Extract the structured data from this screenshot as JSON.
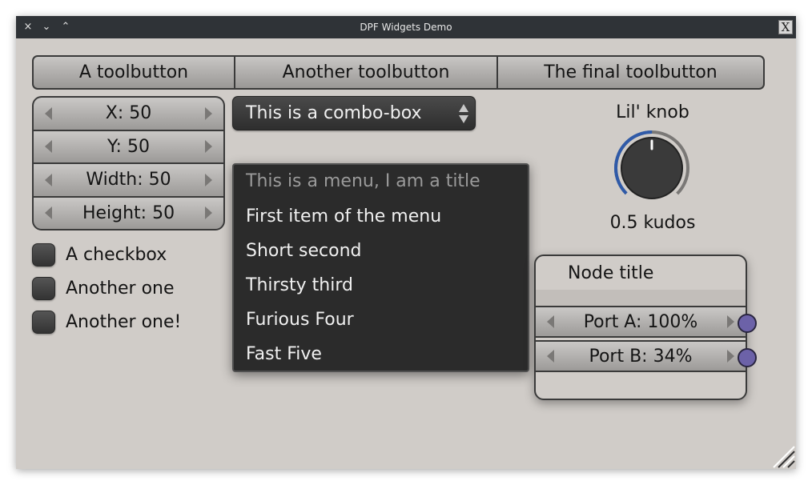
{
  "window": {
    "title": "DPF Widgets Demo",
    "controls": [
      "×",
      "⌄",
      "⌃"
    ]
  },
  "toolbar": {
    "buttons": [
      "A toolbutton",
      "Another toolbutton",
      "The final toolbutton"
    ]
  },
  "spinners": [
    {
      "label": "X: 50"
    },
    {
      "label": "Y: 50"
    },
    {
      "label": "Width: 50"
    },
    {
      "label": "Height: 50"
    }
  ],
  "checkboxes": [
    {
      "label": "A checkbox",
      "checked": false
    },
    {
      "label": "Another one",
      "checked": false
    },
    {
      "label": "Another one!",
      "checked": false
    }
  ],
  "combo": {
    "value": "This is a combo-box"
  },
  "menu": {
    "title": "This is a menu, I am a title",
    "items": [
      "First item of the menu",
      "Short second",
      "Thirsty third",
      "Furious Four",
      "Fast Five"
    ]
  },
  "knob": {
    "label": "Lil' knob",
    "value_text": "0.5 kudos",
    "value": 0.5,
    "accent": "#2f5aa8"
  },
  "node": {
    "title": "Node title",
    "ports": [
      {
        "label": "Port A: 100%"
      },
      {
        "label": "Port B: 34%"
      }
    ],
    "port_color": "#6c62a8"
  },
  "colors": {
    "background": "#d0ccc8",
    "titlebar": "#2f3337",
    "menu": "#2b2b2b"
  }
}
